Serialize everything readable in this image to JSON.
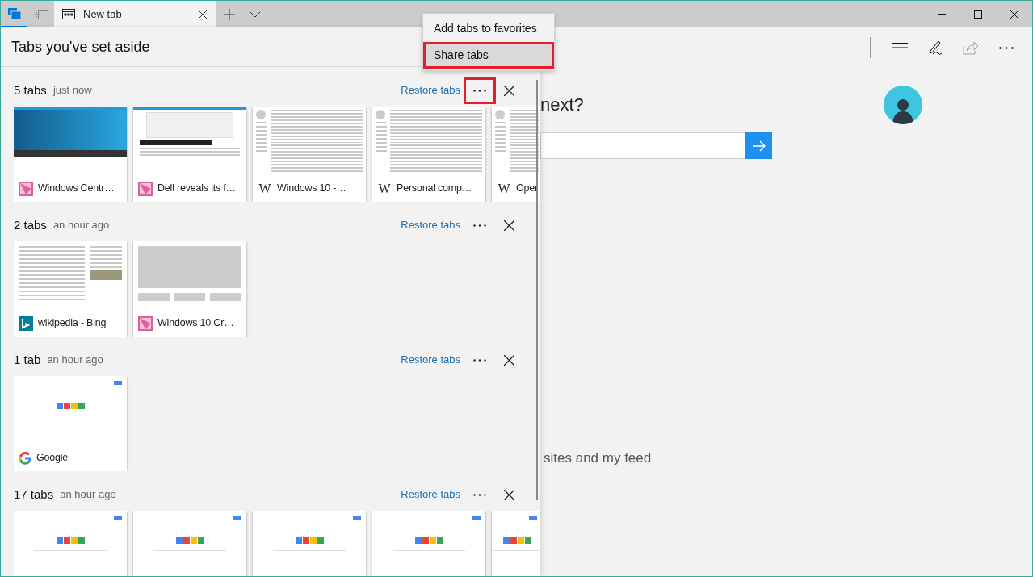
{
  "titlebar": {
    "tab": {
      "title": "New tab",
      "selected": true
    }
  },
  "toolbar": {
    "share_disabled": true
  },
  "page": {
    "heading": "next?",
    "footer_link": "sites and my feed"
  },
  "panel": {
    "title": "Tabs you've set aside",
    "groups": [
      {
        "count": "5 tabs",
        "time": "just now",
        "restore": "Restore tabs",
        "more_highlighted": true,
        "tabs": [
          {
            "title": "Windows Centr…",
            "favicon": {
              "kind": "tile"
            },
            "kind": "banner"
          },
          {
            "title": "Dell reveals its f…",
            "favicon": {
              "kind": "tile"
            },
            "kind": "article"
          },
          {
            "title": "Windows 10 -…",
            "favicon": {
              "kind": "letter",
              "text": "W"
            },
            "kind": "wiki"
          },
          {
            "title": "Personal comp…",
            "favicon": {
              "kind": "letter",
              "text": "W"
            },
            "kind": "wiki"
          },
          {
            "title": "Oper",
            "favicon": {
              "kind": "letter",
              "text": "W"
            },
            "kind": "wiki"
          }
        ]
      },
      {
        "count": "2 tabs",
        "time": "an hour ago",
        "restore": "Restore tabs",
        "more_highlighted": false,
        "tabs": [
          {
            "title": "wikipedia - Bing",
            "favicon": {
              "kind": "bing"
            },
            "kind": "results"
          },
          {
            "title": "Windows 10 Cr…",
            "favicon": {
              "kind": "tile"
            },
            "kind": "loading"
          }
        ]
      },
      {
        "count": "1 tab",
        "time": "an hour ago",
        "restore": "Restore tabs",
        "more_highlighted": false,
        "tabs": [
          {
            "title": "Google",
            "favicon": {
              "kind": "google"
            },
            "kind": "search"
          }
        ]
      },
      {
        "count": "17 tabs",
        "time": "an hour ago",
        "restore": "Restore tabs",
        "more_highlighted": false,
        "tabs": [
          {
            "kind": "search"
          },
          {
            "kind": "search"
          },
          {
            "kind": "search"
          },
          {
            "kind": "search"
          },
          {
            "kind": "search"
          }
        ]
      }
    ]
  },
  "menu": {
    "items": [
      {
        "label": "Add tabs to favorites",
        "highlighted": false
      },
      {
        "label": "Share tabs",
        "highlighted": true
      }
    ]
  }
}
